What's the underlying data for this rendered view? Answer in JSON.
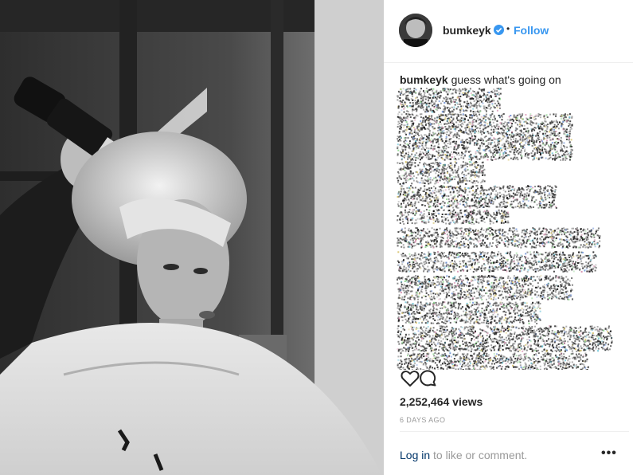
{
  "post": {
    "username": "bumkeyk",
    "follow_label": "Follow",
    "separator": "•",
    "caption_user": "bumkeyk",
    "caption_text": "guess what's going on",
    "views": "2,252,464 views",
    "time_ago": "6 DAYS AGO",
    "login_link": "Log in",
    "login_suffix": " to like or comment.",
    "more_label": "•••"
  },
  "icons": {
    "verified": "verified-badge-icon",
    "like": "heart-icon",
    "comment": "comment-bubble-icon",
    "more": "more-options-icon"
  },
  "colors": {
    "link_blue": "#3897f0",
    "verified_blue": "#3897f0",
    "muted": "#999999",
    "text": "#262626"
  }
}
